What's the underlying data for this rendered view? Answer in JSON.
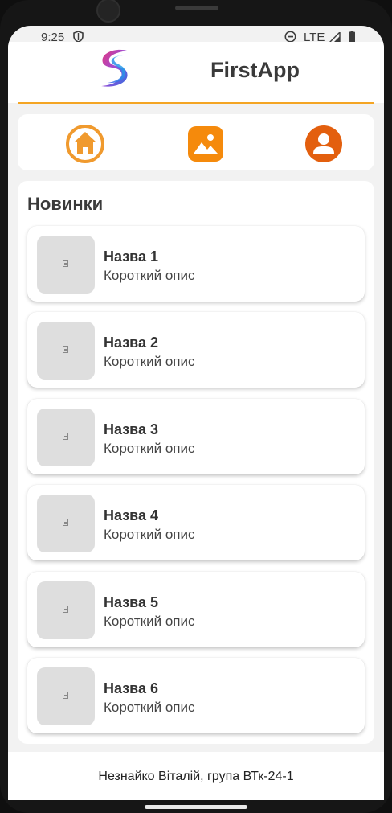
{
  "status_bar": {
    "time": "9:25",
    "network": "LTE"
  },
  "header": {
    "title": "FirstApp",
    "logo_icon": "app-logo-icon",
    "accent_color": "#f4a524"
  },
  "nav": {
    "items": [
      {
        "icon": "home-icon",
        "color": "#f09a2e"
      },
      {
        "icon": "image-icon",
        "color": "#f58a0c"
      },
      {
        "icon": "person-icon",
        "color": "#e35f0e"
      }
    ]
  },
  "section": {
    "title": "Новинки"
  },
  "items": [
    {
      "title": "Назва 1",
      "description": "Короткий опис"
    },
    {
      "title": "Назва 2",
      "description": "Короткий опис"
    },
    {
      "title": "Назва 3",
      "description": "Короткий опис"
    },
    {
      "title": "Назва 4",
      "description": "Короткий опис"
    },
    {
      "title": "Назва 5",
      "description": "Короткий опис"
    },
    {
      "title": "Назва 6",
      "description": "Короткий опис"
    }
  ],
  "footer": {
    "text": "Незнайко Віталій, група ВТк-24-1"
  }
}
